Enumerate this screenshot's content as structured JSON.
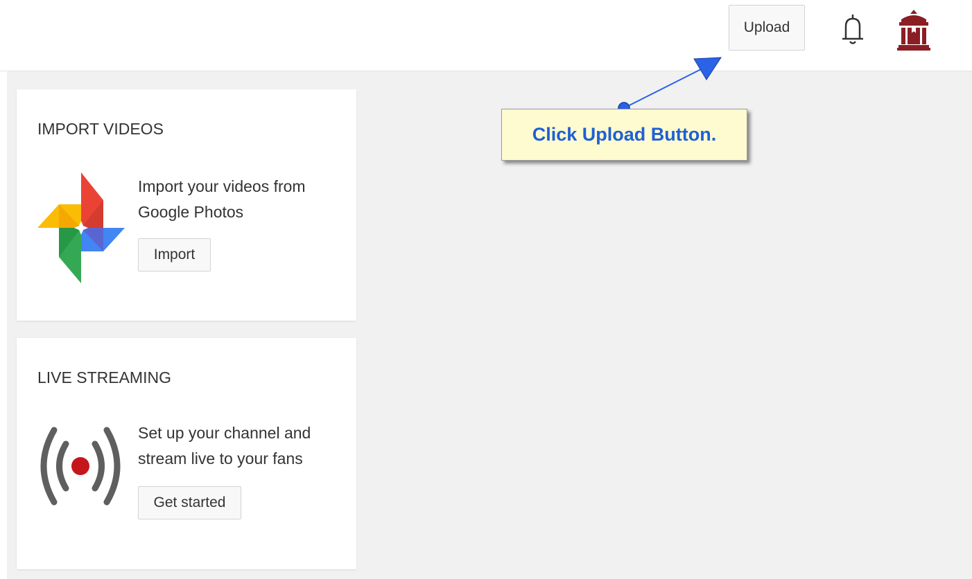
{
  "header": {
    "upload_label": "Upload"
  },
  "icons": {
    "notifications": "bell-icon",
    "account": "building-avatar-icon",
    "photos": "google-photos-pinwheel-icon",
    "live": "live-broadcast-icon"
  },
  "cards": {
    "import": {
      "title": "IMPORT VIDEOS",
      "line1": "Import your videos from",
      "line2": "Google Photos",
      "button_label": "Import"
    },
    "live": {
      "title": "LIVE STREAMING",
      "line1": "Set up your channel and",
      "line2": "stream live to your fans",
      "button_label": "Get started"
    }
  },
  "callout": {
    "text": "Click Upload Button."
  },
  "colors": {
    "background": "#f1f1f1",
    "card": "#ffffff",
    "callout_fill": "#fdfbcf",
    "callout_text": "#1f5fd6",
    "arrow": "#2a62e8",
    "live_dot": "#c4161c",
    "avatar": "#8b1d24"
  }
}
